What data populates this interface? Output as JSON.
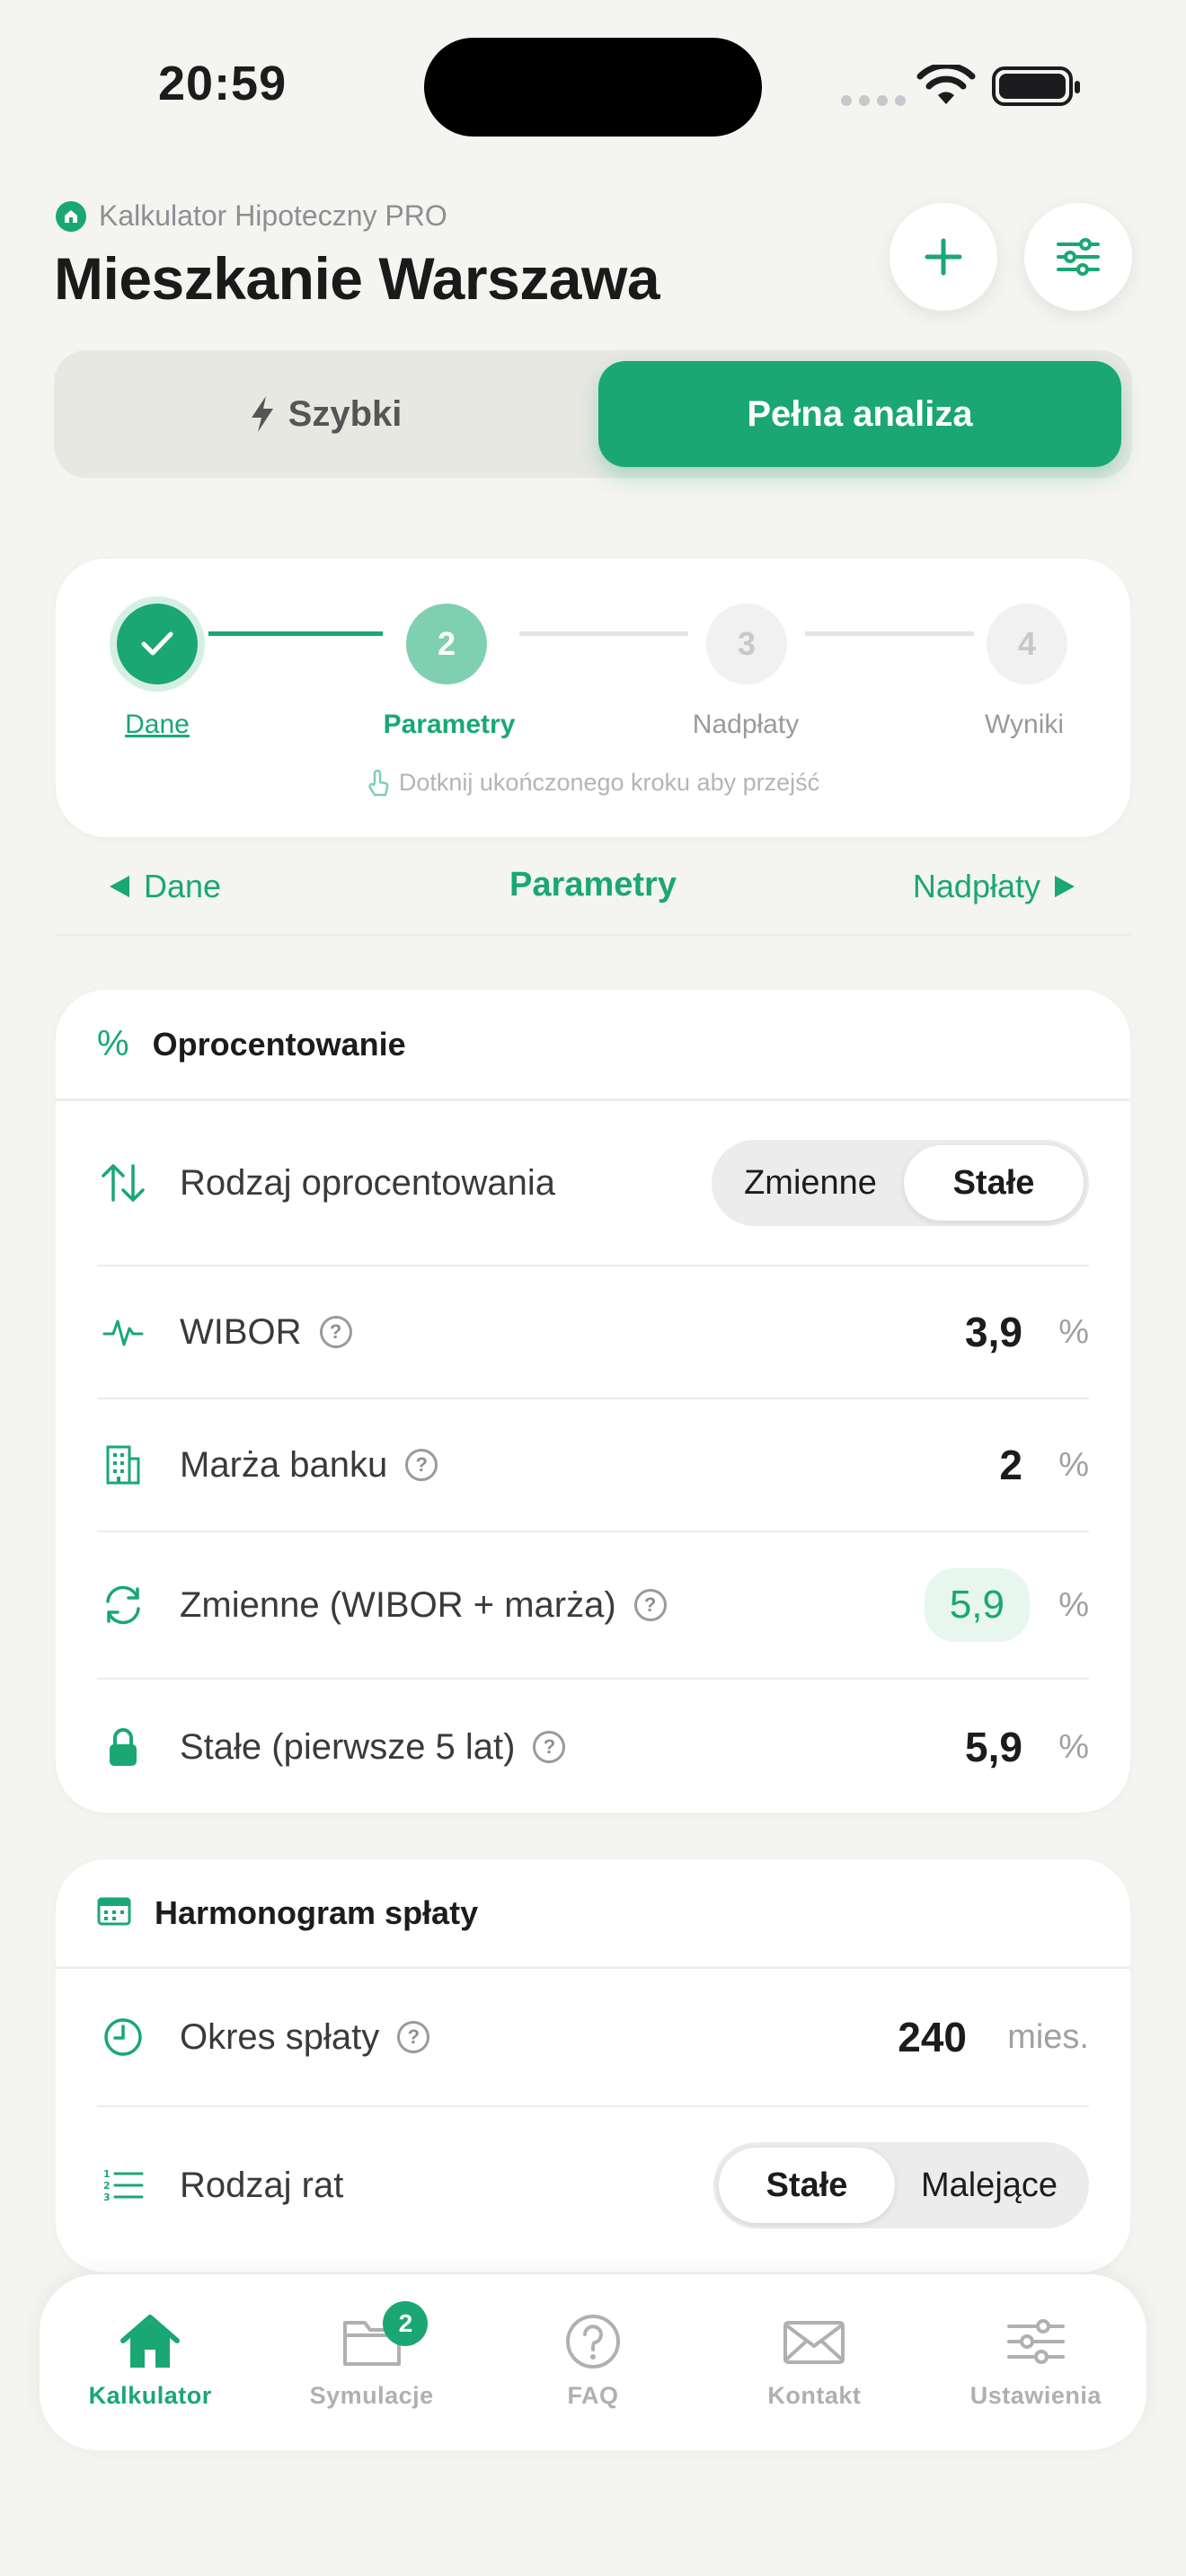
{
  "status_bar": {
    "time": "20:59"
  },
  "header": {
    "app_name": "Kalkulator Hipoteczny PRO",
    "title": "Mieszkanie Warszawa"
  },
  "mode_toggle": {
    "quick_label": "Szybki",
    "full_label": "Pełna analiza",
    "selected": "Pełna analiza"
  },
  "stepper": {
    "steps": [
      {
        "number": "1",
        "label": "Dane",
        "state": "done"
      },
      {
        "number": "2",
        "label": "Parametry",
        "state": "current"
      },
      {
        "number": "3",
        "label": "Nadpłaty",
        "state": "upcoming"
      },
      {
        "number": "4",
        "label": "Wyniki",
        "state": "upcoming"
      }
    ],
    "hint": "Dotknij ukończonego kroku aby przejść"
  },
  "step_nav": {
    "prev": "Dane",
    "current": "Parametry",
    "next": "Nadpłaty"
  },
  "interest_section": {
    "icon_text": "%",
    "title": "Oprocentowanie",
    "rate_type": {
      "label": "Rodzaj oprocentowania",
      "options": [
        "Zmienne",
        "Stałe"
      ],
      "selected": "Stałe"
    },
    "wibor": {
      "label": "WIBOR",
      "value": "3,9",
      "unit": "%"
    },
    "margin": {
      "label": "Marża banku",
      "value": "2",
      "unit": "%"
    },
    "variable": {
      "label": "Zmienne (WIBOR + marża)",
      "value": "5,9",
      "unit": "%"
    },
    "fixed": {
      "label": "Stałe (pierwsze 5 lat)",
      "value": "5,9",
      "unit": "%"
    },
    "help_glyph": "?"
  },
  "schedule_section": {
    "title": "Harmonogram spłaty",
    "period": {
      "label": "Okres spłaty",
      "value": "240",
      "unit": "mies."
    },
    "installment_type": {
      "label": "Rodzaj rat",
      "options": [
        "Stałe",
        "Malejące"
      ],
      "selected": "Stałe"
    }
  },
  "bottom_nav": {
    "items": [
      {
        "label": "Kalkulator",
        "icon": "home-icon",
        "active": true
      },
      {
        "label": "Symulacje",
        "icon": "folder-icon",
        "badge": "2"
      },
      {
        "label": "FAQ",
        "icon": "question-icon"
      },
      {
        "label": "Kontakt",
        "icon": "mail-icon"
      },
      {
        "label": "Ustawienia",
        "icon": "sliders-icon"
      }
    ]
  },
  "colors": {
    "accent": "#1aa774",
    "accent_light": "#7fd0b0",
    "background": "#f4f4f0",
    "card": "#ffffff"
  }
}
